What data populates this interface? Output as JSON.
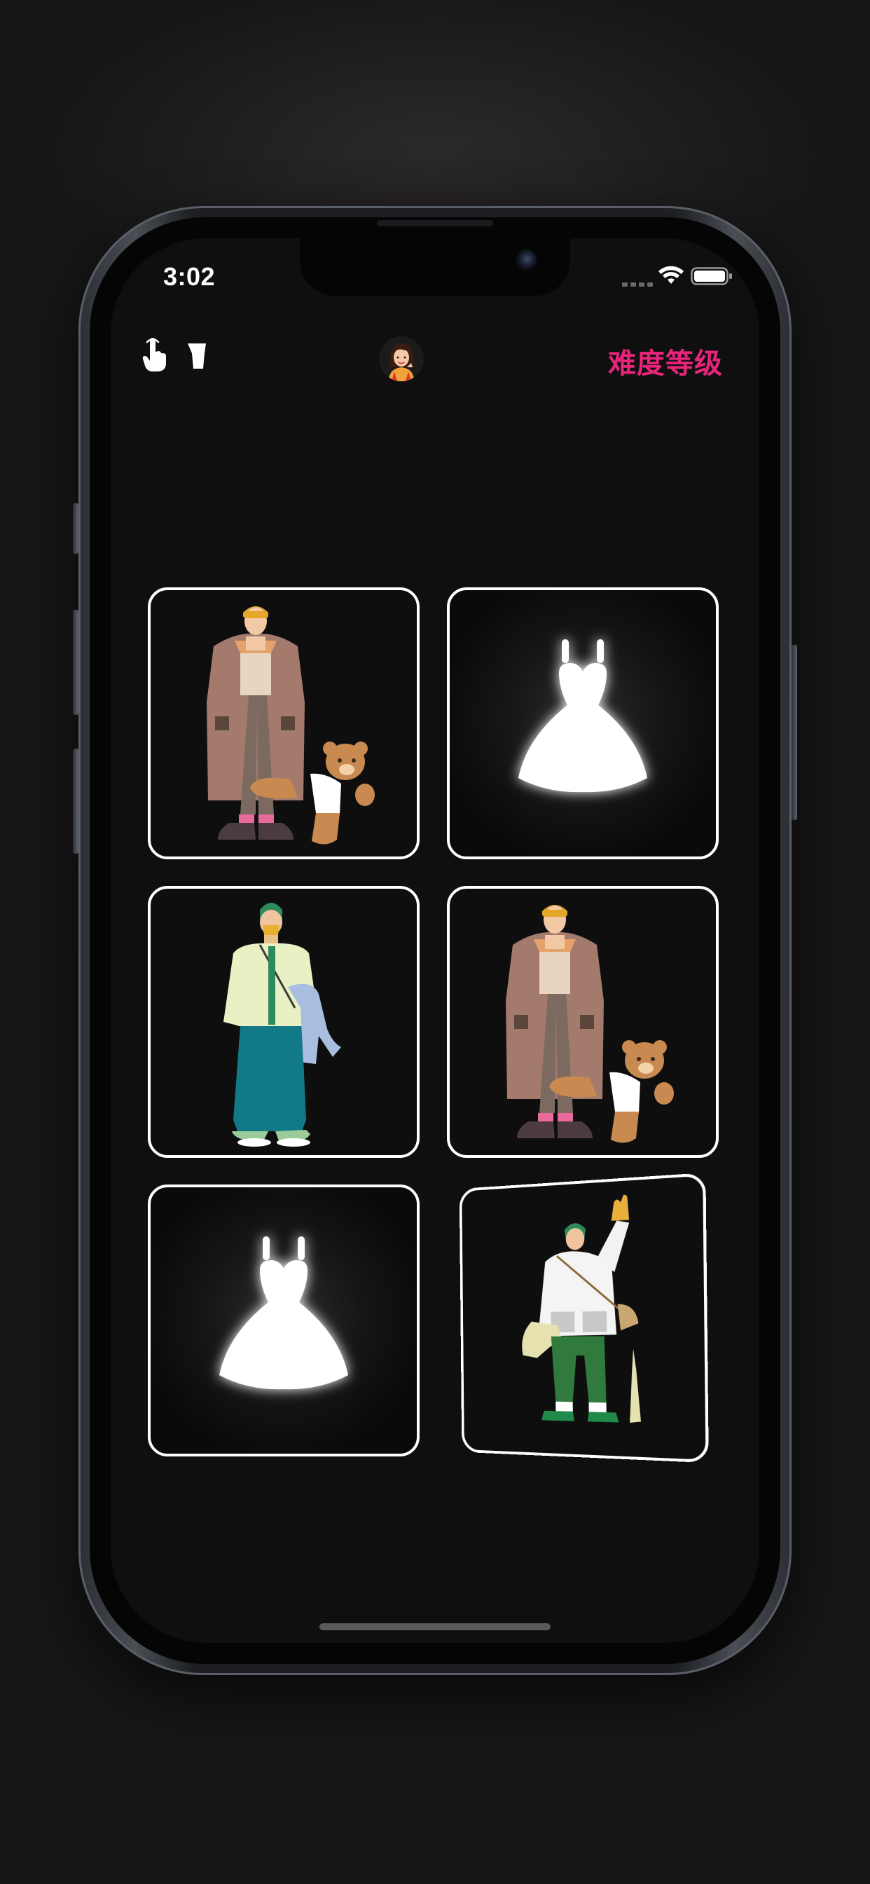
{
  "status_bar": {
    "time": "3:02",
    "icons": [
      "cellular-signal-icon",
      "wifi-icon",
      "battery-icon"
    ]
  },
  "toolbar": {
    "left_icons": [
      "hand-pointer-icon",
      "cup-icon"
    ],
    "avatar_icon": "girl-avatar-icon",
    "difficulty_label": "难度等级"
  },
  "theme": {
    "accent": "#e8247a",
    "card_border": "#ffffff",
    "screen_bg": "#0f0f0f",
    "backdrop_glow": "#82145a"
  },
  "grid": {
    "cards": [
      {
        "content": "man-brown-coat-teddy-bear",
        "state": "face-up"
      },
      {
        "content": "white-dress-silhouette",
        "state": "hidden"
      },
      {
        "content": "woman-green-scarf",
        "state": "face-up"
      },
      {
        "content": "man-brown-coat-teddy-bear",
        "state": "face-up"
      },
      {
        "content": "white-dress-silhouette",
        "state": "hidden"
      },
      {
        "content": "girl-green-waving",
        "state": "flipping"
      }
    ]
  }
}
